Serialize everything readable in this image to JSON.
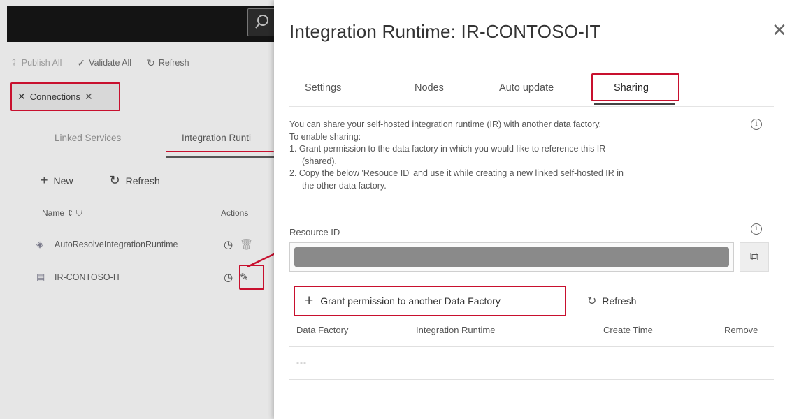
{
  "left_pane": {
    "toolbar": {
      "publish_all": "Publish All",
      "validate_all": "Validate All",
      "refresh": "Refresh"
    },
    "connections_tab": {
      "label": "Connections"
    },
    "subtabs": {
      "linked_services": "Linked Services",
      "integration_runtimes": "Integration Runti"
    },
    "actions": {
      "new": "New",
      "refresh": "Refresh"
    },
    "list_header": {
      "name": "Name ⇕",
      "actions": "Actions"
    },
    "rows": [
      {
        "name": "AutoResolveIntegrationRuntime",
        "icon": "cloud-runtime-icon"
      },
      {
        "name": "IR-CONTOSO-IT",
        "icon": "server-icon"
      }
    ]
  },
  "panel": {
    "title": "Integration Runtime: IR-CONTOSO-IT",
    "tabs": [
      {
        "label": "Settings"
      },
      {
        "label": "Nodes"
      },
      {
        "label": "Auto update"
      },
      {
        "label": "Sharing",
        "active": true
      }
    ],
    "info": {
      "line1": "You can share your self-hosted integration runtime (IR) with another data factory.",
      "line2": "To enable sharing:",
      "step1a": "1. Grant permission to the data factory in which you would like to reference this IR",
      "step1b": "(shared).",
      "step2a": "2. Copy the below 'Resouce ID' and use it while creating a new linked self-hosted IR in",
      "step2b": "the other data factory."
    },
    "resource_id_label": "Resource ID",
    "resource_id_value": "",
    "grant_button": "Grant permission to another Data Factory",
    "refresh": "Refresh",
    "table": {
      "headers": [
        "Data Factory",
        "Integration Runtime",
        "Create Time",
        "Remove"
      ],
      "empty_text": "---"
    }
  },
  "colors": {
    "highlight": "#c8102e",
    "topbar": "#141414"
  }
}
